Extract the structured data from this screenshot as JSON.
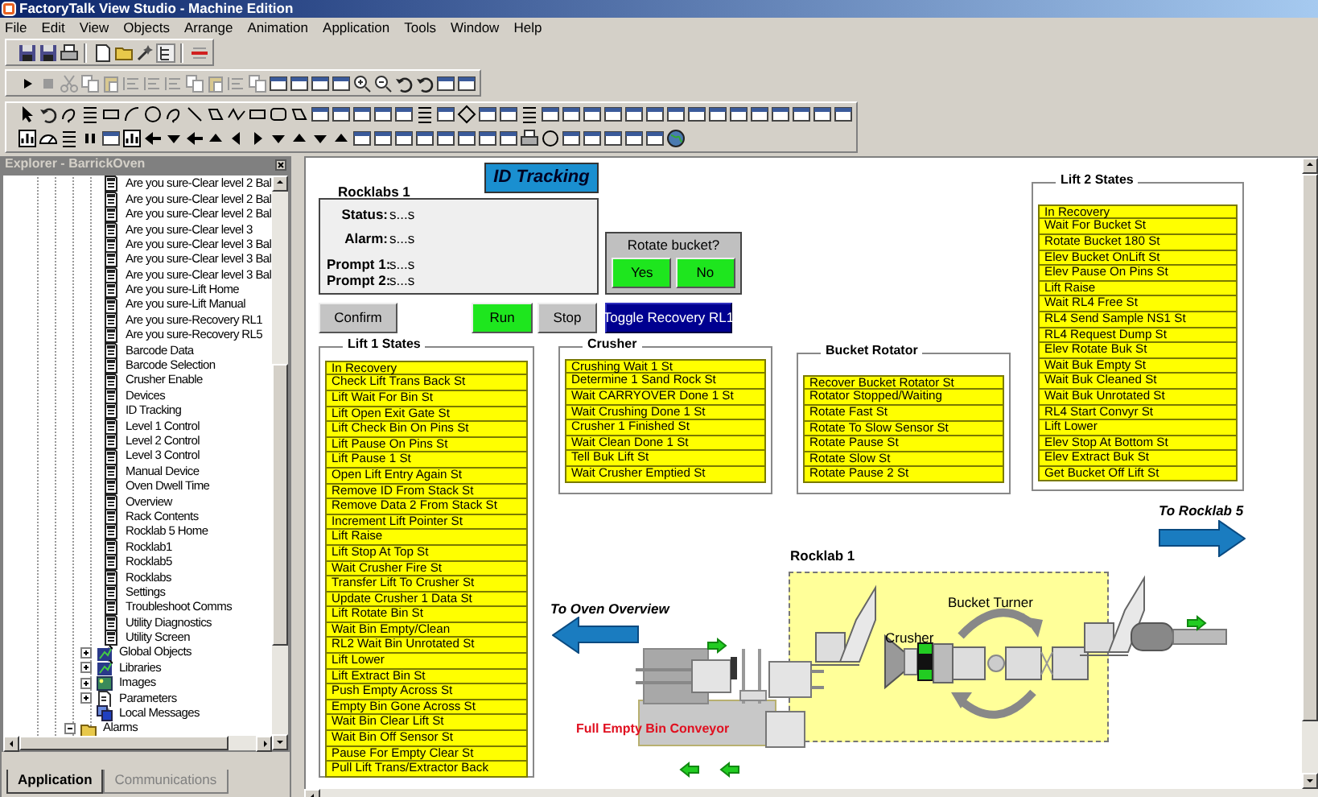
{
  "window": {
    "title": "FactoryTalk View Studio - Machine Edition"
  },
  "menu": [
    "File",
    "Edit",
    "View",
    "Objects",
    "Arrange",
    "Animation",
    "Application",
    "Tools",
    "Window",
    "Help"
  ],
  "explorer": {
    "title": "Explorer - BarrickOven",
    "screens": [
      "Are you sure-Clear level 2 Bal",
      "Are you sure-Clear level 2 Bal",
      "Are you sure-Clear level 2 Bal",
      "Are you sure-Clear level 3",
      "Are you sure-Clear level 3 Bal",
      "Are you sure-Clear level 3 Bal",
      "Are you sure-Clear level 3 Bal",
      "Are you sure-Lift Home",
      "Are you sure-Lift Manual",
      "Are you sure-Recovery RL1",
      "Are you sure-Recovery RL5",
      "Barcode Data",
      "Barcode Selection",
      "Crusher Enable",
      "Devices",
      "ID Tracking",
      "Level 1 Control",
      "Level 2 Control",
      "Level 3 Control",
      "Manual Device",
      "Oven Dwell Time",
      "Overview",
      "Rack Contents",
      "Rocklab 5 Home",
      "Rocklab1",
      "Rocklab5",
      "Rocklabs",
      "Settings",
      "Troubleshoot Comms",
      "Utility Diagnostics",
      "Utility Screen"
    ],
    "folders": [
      {
        "label": "Global Objects",
        "kind": "objects",
        "expanded": false
      },
      {
        "label": "Libraries",
        "kind": "objects",
        "expanded": false
      },
      {
        "label": "Images",
        "kind": "images",
        "expanded": false
      },
      {
        "label": "Parameters",
        "kind": "parameters",
        "expanded": false
      },
      {
        "label": "Local Messages",
        "kind": "messages"
      }
    ],
    "alarms": {
      "label": "Alarms",
      "expanded": true
    },
    "tabs": [
      {
        "label": "Application",
        "selected": true
      },
      {
        "label": "Communications",
        "selected": false
      }
    ]
  },
  "display": {
    "title_button": "ID Tracking",
    "panel_title": "Rocklabs 1",
    "fields": [
      {
        "label": "Status:",
        "value": "s...s"
      },
      {
        "label": "Alarm:",
        "value": "s...s"
      },
      {
        "label": "Prompt 1:",
        "value": "s...s"
      },
      {
        "label": "Prompt 2:",
        "value": "s...s"
      }
    ],
    "prompt": {
      "question": "Rotate bucket?",
      "buttons": [
        "Yes",
        "No"
      ]
    },
    "buttons": [
      {
        "label": "Confirm",
        "kind": "neutral"
      },
      {
        "label": "Run",
        "kind": "go"
      },
      {
        "label": "Stop",
        "kind": "neutral"
      },
      {
        "label": "Toggle Recovery RL1",
        "kind": "toggle"
      }
    ],
    "state_groups": [
      {
        "title": "Lift 1 States",
        "items": [
          "In Recovery",
          "Check Lift Trans Back St",
          "Lift Wait For Bin St",
          "Lift Open Exit Gate St",
          "Lift Check Bin On Pins St",
          "Lift Pause On Pins St",
          "Lift Pause 1 St",
          "Open Lift Entry Again St",
          "Remove ID From Stack St",
          "Remove Data 2 From Stack St",
          "Increment Lift Pointer St",
          "Lift Raise",
          "Lift Stop At Top St",
          "Wait Crusher Fire St",
          "Transfer Lift To Crusher St",
          "Update Crusher 1 Data St",
          "Lift Rotate Bin St",
          "Wait Bin Empty/Clean",
          "RL2 Wait Bin Unrotated St",
          "Lift Lower",
          "Lift Extract Bin St",
          "Push Empty Across St",
          "Empty Bin Gone Across St",
          "Wait Bin Clear Lift St",
          "Wait Bin Off Sensor St",
          "Pause For Empty Clear St",
          "Pull Lift Trans/Extractor Back"
        ]
      },
      {
        "title": "Crusher",
        "items": [
          "Crushing Wait 1 St",
          "Determine 1 Sand Rock St",
          "Wait CARRYOVER Done 1 St",
          "Wait Crushing Done 1 St",
          "Crusher 1 Finished St",
          "Wait Clean Done 1 St",
          "Tell Buk Lift St",
          "Wait Crusher Emptied St"
        ]
      },
      {
        "title": "Bucket Rotator",
        "items": [
          "Recover Bucket Rotator St",
          "Rotator Stopped/Waiting",
          "Rotate Fast St",
          "Rotate To Slow Sensor St",
          "Rotate Pause St",
          "Rotate Slow St",
          "Rotate Pause 2 St"
        ]
      },
      {
        "title": "Lift 2 States",
        "items": [
          "In Recovery",
          "Wait For Bucket St",
          "Rotate Bucket 180 St",
          "Elev Bucket OnLift St",
          "Elev Pause On Pins St",
          "Lift Raise",
          "Wait RL4 Free St",
          "RL4 Send Sample NS1 St",
          "RL4 Request Dump St",
          "Elev Rotate Buk St",
          "Wait Buk Empty St",
          "Wait Buk Cleaned St",
          "Wait Buk Unrotated St",
          "RL4 Start Convyr St",
          "Lift Lower",
          "Elev Stop At Bottom St",
          "Elev Extract Buk St",
          "Get Bucket Off Lift St"
        ]
      }
    ],
    "nav": [
      {
        "label": "To Rocklab 5"
      },
      {
        "label": "To Oven Overview"
      }
    ],
    "area": {
      "title": "Rocklab 1",
      "labels": [
        "Crusher",
        "Bucket Turner"
      ]
    },
    "conveyor_label": "Full Empty Bin Conveyor"
  }
}
